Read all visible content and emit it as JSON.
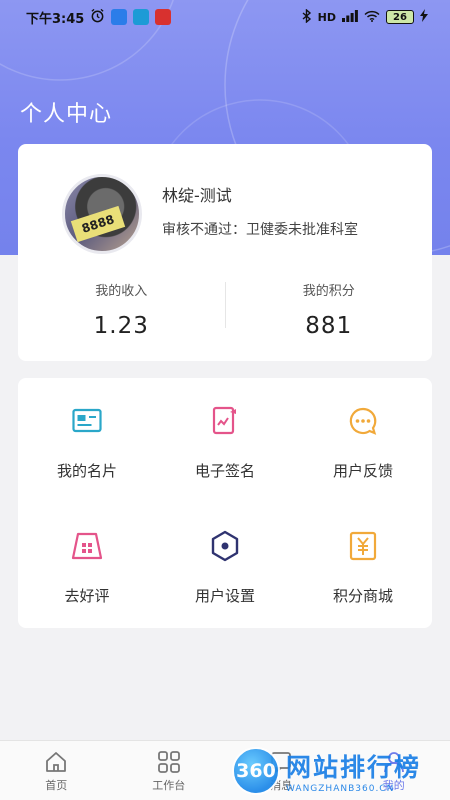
{
  "status_bar": {
    "time": "下午3:45",
    "network": "HD",
    "battery": "26"
  },
  "page_title": "个人中心",
  "profile": {
    "avatar_tag": "8888",
    "name": "林绽-测试",
    "review_status": "审核不通过：卫健委未批准科室",
    "income_label": "我的收入",
    "income_value": "1.23",
    "points_label": "我的积分",
    "points_value": "881"
  },
  "menu": [
    {
      "label": "我的名片",
      "icon": "business-card-icon",
      "color": "#2aa7c9"
    },
    {
      "label": "电子签名",
      "icon": "signature-pad-icon",
      "color": "#e4548a"
    },
    {
      "label": "用户反馈",
      "icon": "chat-bubble-icon",
      "color": "#f1a93a"
    },
    {
      "label": "去好评",
      "icon": "store-rating-icon",
      "color": "#e4548a"
    },
    {
      "label": "用户设置",
      "icon": "hexagon-settings-icon",
      "color": "#2f3370"
    },
    {
      "label": "积分商城",
      "icon": "yen-coupon-icon",
      "color": "#f1a93a"
    }
  ],
  "tabs": [
    {
      "label": "首页",
      "icon": "home-icon"
    },
    {
      "label": "工作台",
      "icon": "grid-icon"
    },
    {
      "label": "消息",
      "icon": "message-icon"
    },
    {
      "label": "我的",
      "icon": "user-icon"
    }
  ],
  "watermark": {
    "badge": "360",
    "title": "网站排行榜",
    "subtitle": "WANGZHANB360.CN"
  },
  "colors": {
    "header_gradient_top": "#8d97f2",
    "header_gradient_bottom": "#7482ec",
    "accent": "#6e7bea"
  }
}
